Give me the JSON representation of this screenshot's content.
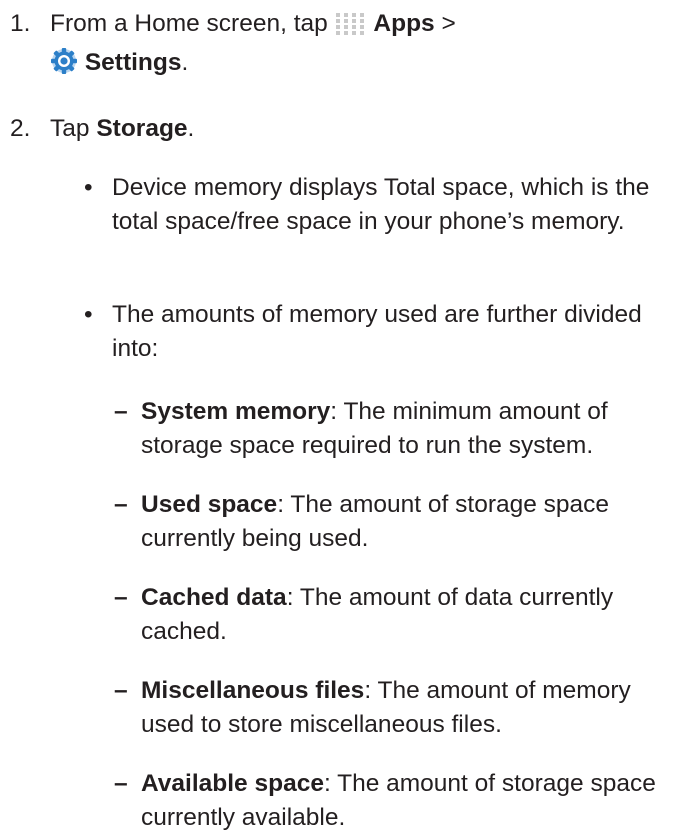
{
  "steps": [
    {
      "number": "1.",
      "prefix": "From a Home screen, tap",
      "apps_label": "Apps",
      "separator": ">",
      "settings_label": "Settings",
      "suffix": "."
    },
    {
      "number": "2.",
      "prefix": "Tap",
      "storage_label": "Storage",
      "suffix": "."
    }
  ],
  "icons": {
    "apps": "apps-grid-icon",
    "settings": "settings-gear-icon"
  },
  "colors": {
    "text": "#231f20",
    "apps_icon": "#c9c9c9",
    "settings_icon": "#2c7fc8"
  },
  "bullets": [
    {
      "text": "Device memory displays Total space, which is the total space/free space in your phone’s memory."
    },
    {
      "text": "The amounts of memory used are further divided into:"
    }
  ],
  "items": [
    {
      "term": "System memory",
      "desc": ": The minimum amount of storage space required to run the system."
    },
    {
      "term": "Used space",
      "desc": ": The amount of storage space currently being used."
    },
    {
      "term": "Cached data",
      "desc": ": The amount of data currently cached."
    },
    {
      "term": "Miscellaneous files",
      "desc": ": The amount of memory used to store miscellaneous files."
    },
    {
      "term": "Available space",
      "desc": ": The amount of storage space currently available."
    }
  ],
  "glyphs": {
    "bullet": "•",
    "dash": "–"
  }
}
